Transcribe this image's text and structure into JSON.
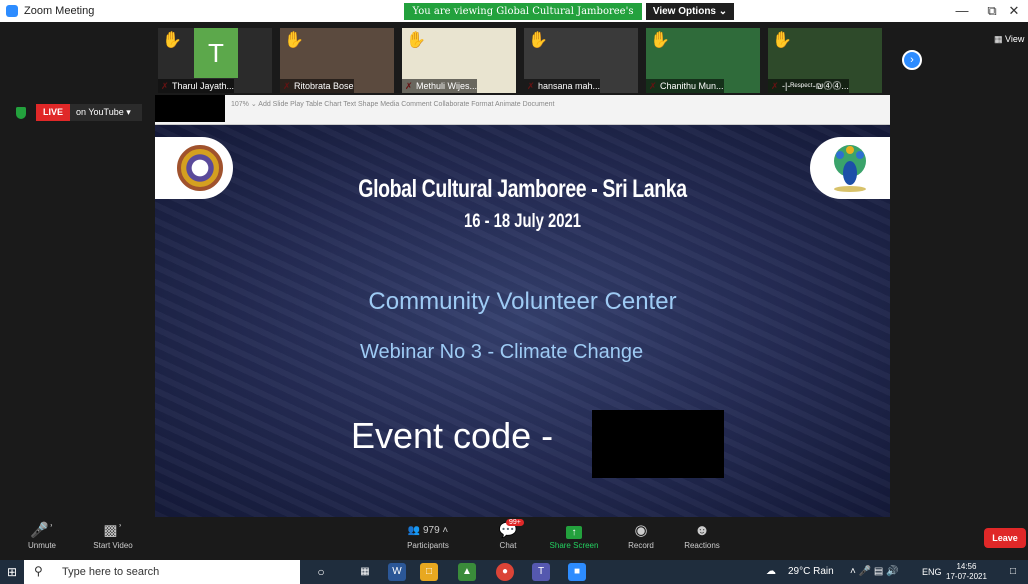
{
  "titlebar": {
    "app_title": "Zoom Meeting",
    "share_banner": "You are viewing Global Cultural Jamboree's screen",
    "view_options": "View Options ⌄",
    "minimize": "—",
    "restore": "⧉",
    "close": "✕"
  },
  "participants": [
    {
      "name": "Tharul Jayath..."
    },
    {
      "name": "Ritobrata Bose"
    },
    {
      "name": "Methuli Wijes..."
    },
    {
      "name": "hansana mah..."
    },
    {
      "name": "Chanithu Mun..."
    },
    {
      "name": "-|-ᴿᵉˢᵖᵉᶜᵗ-₪⓸⓸..."
    }
  ],
  "avatar_letter": "T",
  "next_page_icon": "›",
  "view_button": "▦ View",
  "live": {
    "badge": "LIVE",
    "platform": "on YouTube ▾"
  },
  "ppt": {
    "tools": "107%  ⌄      Add Slide                     Play                                  Table   Chart   Text   Shape   Media   Comment                          Collaborate                               Format   Animate   Document"
  },
  "slide": {
    "title": "Global Cultural Jamboree - Sri Lanka",
    "date": "16 - 18 July 2021",
    "line1": "Community Volunteer Center",
    "line2": "Webinar No 3 - Climate Change",
    "event_code": "Event code -"
  },
  "controls": {
    "unmute": "Unmute",
    "start_video": "Start Video",
    "participants": "Participants",
    "participant_count": "979",
    "chat": "Chat",
    "chat_badge": "99+",
    "share_screen": "Share Screen",
    "record": "Record",
    "reactions": "Reactions",
    "leave": "Leave"
  },
  "taskbar": {
    "search_placeholder": "Type here to search",
    "weather": "29°C  Rain",
    "lang": "ENG",
    "time": "14:56",
    "date": "17-07-2021"
  },
  "colors": {
    "zoom_blue": "#2d8cff",
    "live_red": "#e02828",
    "share_green": "#23a13d",
    "slide_text_blue": "#9ecbf4"
  }
}
